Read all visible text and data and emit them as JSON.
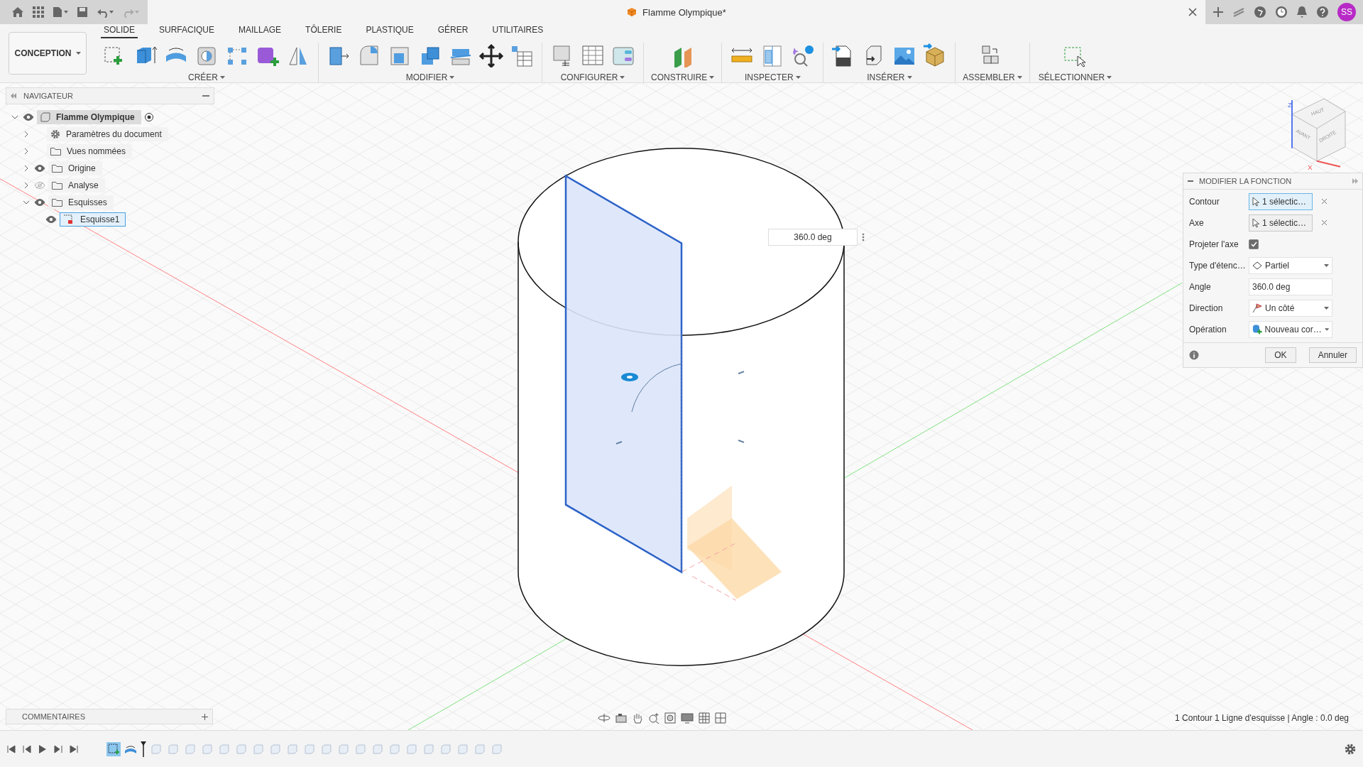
{
  "title_bar": {
    "document_title": "Flamme Olympique*",
    "user_initials": "SS"
  },
  "workspace_button": {
    "label": "CONCEPTION"
  },
  "ribbon_tabs": [
    {
      "label": "SOLIDE",
      "selected": true
    },
    {
      "label": "SURFACIQUE",
      "selected": false
    },
    {
      "label": "MAILLAGE",
      "selected": false
    },
    {
      "label": "TÔLERIE",
      "selected": false
    },
    {
      "label": "PLASTIQUE",
      "selected": false
    },
    {
      "label": "GÉRER",
      "selected": false
    },
    {
      "label": "UTILITAIRES",
      "selected": false
    }
  ],
  "ribbon_groups": [
    {
      "label": "CRÉER"
    },
    {
      "label": "MODIFIER"
    },
    {
      "label": "CONFIGURER"
    },
    {
      "label": "CONSTRUIRE"
    },
    {
      "label": "INSPECTER"
    },
    {
      "label": "INSÉRER"
    },
    {
      "label": "ASSEMBLER"
    },
    {
      "label": "SÉLECTIONNER"
    }
  ],
  "navigator": {
    "title": "NAVIGATEUR",
    "tree": [
      {
        "label": "Flamme Olympique",
        "kind": "component",
        "visible": true,
        "expanded": true,
        "selected": false,
        "children": [
          {
            "label": "Paramètres du document",
            "kind": "settings",
            "expanded": false,
            "selected": false
          },
          {
            "label": "Vues nommées",
            "kind": "folder",
            "expanded": false,
            "selected": false
          },
          {
            "label": "Origine",
            "kind": "folder",
            "visible": true,
            "expanded": false,
            "selected": false
          },
          {
            "label": "Analyse",
            "kind": "folder",
            "visible": false,
            "expanded": false,
            "selected": false
          },
          {
            "label": "Esquisses",
            "kind": "folder",
            "visible": true,
            "expanded": true,
            "selected": false,
            "children": [
              {
                "label": "Esquisse1",
                "kind": "sketch",
                "visible": true,
                "selected": true
              }
            ]
          }
        ]
      }
    ]
  },
  "viewport": {
    "angle_input": {
      "value": "360.0 deg"
    },
    "view_cube": {
      "faces": [
        "HAUT",
        "AVANT",
        "DROITE"
      ],
      "axes": [
        "Z",
        "X"
      ]
    }
  },
  "feature_dialog": {
    "title": "MODIFIER LA FONCTION",
    "rows": [
      {
        "label": "Contour",
        "kind": "selection",
        "value": "1 sélectic…",
        "focused": true
      },
      {
        "label": "Axe",
        "kind": "selection",
        "value": "1 sélectic…",
        "focused": false
      },
      {
        "label": "Projeter l'axe",
        "kind": "checkbox",
        "checked": true
      },
      {
        "label": "Type d'étenc…",
        "kind": "dropdown",
        "value": "Partiel"
      },
      {
        "label": "Angle",
        "kind": "input",
        "value": "360.0 deg"
      },
      {
        "label": "Direction",
        "kind": "dropdown",
        "value": "Un côté"
      },
      {
        "label": "Opération",
        "kind": "dropdown",
        "value": "Nouveau cor…"
      }
    ],
    "buttons": [
      "OK",
      "Annuler"
    ]
  },
  "comments": {
    "title": "COMMENTAIRES"
  },
  "status_text": "1 Contour 1 Ligne d'esquisse | Angle : 0.0 deg"
}
